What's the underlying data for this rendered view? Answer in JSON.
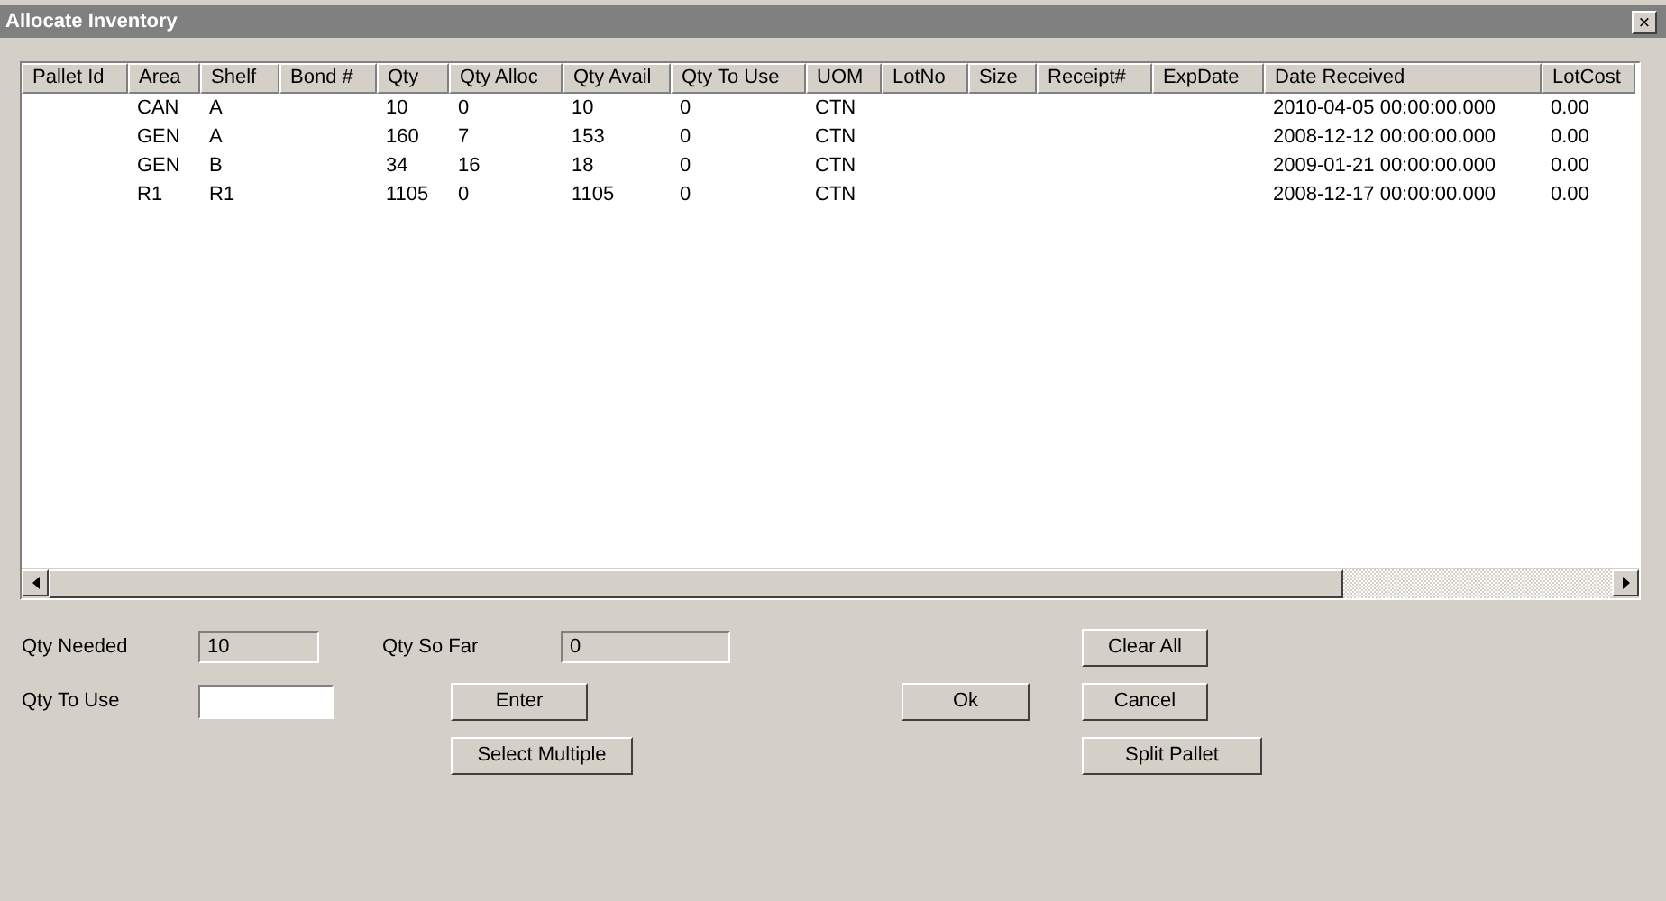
{
  "window": {
    "title": "Allocate Inventory",
    "close": "×"
  },
  "table": {
    "columns": [
      "Pallet Id",
      "Area",
      "Shelf",
      "Bond #",
      "Qty",
      "Qty Alloc",
      "Qty Avail",
      "Qty To Use",
      "UOM",
      "LotNo",
      "Size",
      "Receipt#",
      "ExpDate",
      "Date Received",
      "LotCost"
    ],
    "rows": [
      [
        "",
        "CAN",
        "A",
        "",
        "10",
        "0",
        "10",
        "0",
        "CTN",
        "",
        "",
        "",
        "",
        "2010-04-05 00:00:00.000",
        "0.00"
      ],
      [
        "",
        "GEN",
        "A",
        "",
        "160",
        "7",
        "153",
        "0",
        "CTN",
        "",
        "",
        "",
        "",
        "2008-12-12 00:00:00.000",
        "0.00"
      ],
      [
        "",
        "GEN",
        "B",
        "",
        "34",
        "16",
        "18",
        "0",
        "CTN",
        "",
        "",
        "",
        "",
        "2009-01-21 00:00:00.000",
        "0.00"
      ],
      [
        "",
        "R1",
        "R1",
        "",
        "1105",
        "0",
        "1105",
        "0",
        "CTN",
        "",
        "",
        "",
        "",
        "2008-12-17 00:00:00.000",
        "0.00"
      ]
    ]
  },
  "form": {
    "qty_needed": {
      "label": "Qty Needed",
      "value": "10"
    },
    "qty_so_far": {
      "label": "Qty So Far",
      "value": "0"
    },
    "qty_to_use": {
      "label": "Qty To Use"
    }
  },
  "buttons": {
    "clear_all": "Clear All",
    "enter": "Enter",
    "ok": "Ok",
    "cancel": "Cancel",
    "select_multiple": "Select Multiple",
    "split_pallet": "Split Pallet"
  }
}
